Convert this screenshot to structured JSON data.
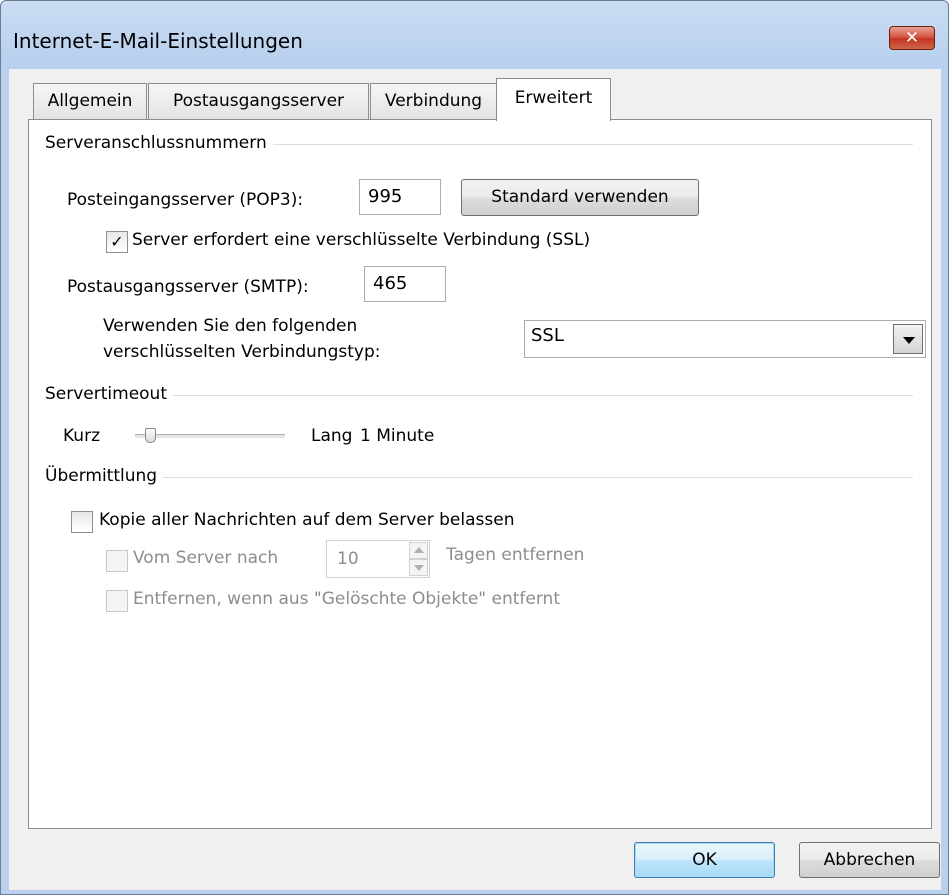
{
  "window": {
    "title": "Internet-E-Mail-Einstellungen",
    "close_icon": "close-icon"
  },
  "tabs": [
    {
      "label": "Allgemein",
      "active": false
    },
    {
      "label": "Postausgangsserver",
      "active": false
    },
    {
      "label": "Verbindung",
      "active": false
    },
    {
      "label": "Erweitert",
      "active": true
    }
  ],
  "server_ports": {
    "group_title": "Serveranschlussnummern",
    "incoming_label": "Posteingangsserver (POP3):",
    "incoming_value": "995",
    "default_button": "Standard verwenden",
    "ssl_checkbox_label": "Server erfordert eine verschlüsselte Verbindung (SSL)",
    "ssl_checked": true,
    "outgoing_label": "Postausgangsserver (SMTP):",
    "outgoing_value": "465",
    "encryption_label_line1": "Verwenden Sie den folgenden",
    "encryption_label_line2": "verschlüsselten Verbindungstyp:",
    "encryption_value": "SSL"
  },
  "timeout": {
    "group_title": "Servertimeout",
    "short_label": "Kurz",
    "long_label": "Lang",
    "value_label": "1 Minute",
    "slider_level": 0.1
  },
  "delivery": {
    "group_title": "Übermittlung",
    "keep_copy_label": "Kopie aller Nachrichten auf dem Server belassen",
    "keep_copy_checked": false,
    "remove_after_label": "Vom Server nach",
    "remove_after_days": "10",
    "days_suffix": "Tagen entfernen",
    "remove_when_deleted_label": "Entfernen, wenn aus \"Gelöschte Objekte\" entfernt"
  },
  "buttons": {
    "ok": "OK",
    "cancel": "Abbrechen"
  },
  "colors": {
    "accent": "#3c7fb1",
    "titlebar": "#b9d1ee",
    "close": "#c2341e"
  }
}
